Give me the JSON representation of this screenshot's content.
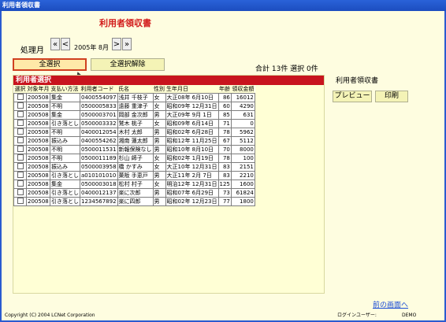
{
  "window": {
    "title": "利用者領収書"
  },
  "main": {
    "heading": "利用者領収書",
    "period_label": "処理月",
    "period_value": "2005年 8月",
    "nav": {
      "first": "«",
      "prev": "<",
      "next": ">",
      "last": "»"
    },
    "select_all": "全選択",
    "deselect_all": "全選択解除",
    "summary": "合計 13件   選択 0件",
    "panel_title": "利用者選択",
    "columns": [
      "選択",
      "対象年月",
      "支払い方法",
      "利用者コード",
      "氏名",
      "性別",
      "生年月日",
      "年齢",
      "領収金額"
    ],
    "rows": [
      {
        "ym": "200508",
        "pay": "集金",
        "code": "0400554097",
        "name": "浅井 千枝子",
        "sex": "女",
        "dob": "大正08年 6月10日",
        "age": "86",
        "amount": "16012"
      },
      {
        "ym": "200508",
        "pay": "不明",
        "code": "0500005833",
        "name": "遠藤 重津子",
        "sex": "女",
        "dob": "昭和09年 12月31日",
        "age": "60",
        "amount": "4290"
      },
      {
        "ym": "200508",
        "pay": "集金",
        "code": "0500003701",
        "name": "岡部 金次郎",
        "sex": "男",
        "dob": "大正09年 9月 1日",
        "age": "85",
        "amount": "631"
      },
      {
        "ym": "200508",
        "pay": "引き落とし",
        "code": "0500003332",
        "name": "鷲木 桃子",
        "sex": "女",
        "dob": "昭和09年 6月14日",
        "age": "71",
        "amount": "0"
      },
      {
        "ym": "200508",
        "pay": "不明",
        "code": "0400012054",
        "name": "木村 太郎",
        "sex": "男",
        "dob": "昭和02年 6月28日",
        "age": "78",
        "amount": "5962"
      },
      {
        "ym": "200508",
        "pay": "振込み",
        "code": "0400554262",
        "name": "湘南 蓮太郎",
        "sex": "男",
        "dob": "昭和12年 11月25日",
        "age": "67",
        "amount": "5112"
      },
      {
        "ym": "200508",
        "pay": "不明",
        "code": "0500011531",
        "name": "新報保険なし",
        "sex": "男",
        "dob": "昭和10年 8月10日",
        "age": "70",
        "amount": "8000"
      },
      {
        "ym": "200508",
        "pay": "不明",
        "code": "0500011189",
        "name": "杉山 師子",
        "sex": "女",
        "dob": "昭和02年 1月19日",
        "age": "78",
        "amount": "100"
      },
      {
        "ym": "200508",
        "pay": "振込み",
        "code": "0500003958",
        "name": "橋 かすみ",
        "sex": "女",
        "dob": "大正10年 12月31日",
        "age": "83",
        "amount": "2151"
      },
      {
        "ym": "200508",
        "pay": "引き落とし",
        "code": "a010101010",
        "name": "菓阪 手恵戸",
        "sex": "男",
        "dob": "大正11年 2月 7日",
        "age": "83",
        "amount": "2210"
      },
      {
        "ym": "200508",
        "pay": "集金",
        "code": "0500003018",
        "name": "松村 村子",
        "sex": "女",
        "dob": "明治12年 12月31日",
        "age": "125",
        "amount": "1600"
      },
      {
        "ym": "200508",
        "pay": "引き落とし",
        "code": "0400012137",
        "name": "楽に次郎",
        "sex": "男",
        "dob": "昭和07年 6月29日",
        "age": "73",
        "amount": "61824"
      },
      {
        "ym": "200508",
        "pay": "引き落とし",
        "code": "1234567892",
        "name": "楽に四郎",
        "sex": "男",
        "dob": "昭和02年 12月23日",
        "age": "77",
        "amount": "1800"
      }
    ],
    "right_label": "利用者領収書",
    "preview": "プレビュー",
    "print": "印刷",
    "back_link": "前の画面へ"
  },
  "footer": {
    "copyright": "Copyright (C) 2004 LCNet Corporation",
    "login_label": "ログインユーザー:",
    "login_user": "DEMO"
  }
}
